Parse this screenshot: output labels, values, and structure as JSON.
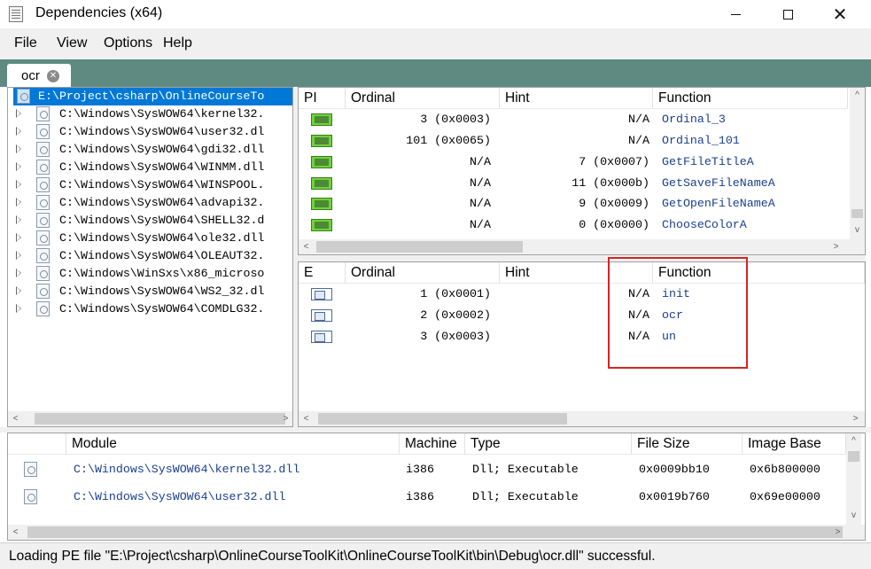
{
  "window": {
    "title": "Dependencies (x64)"
  },
  "menu": [
    "File",
    "View",
    "Options",
    "Help"
  ],
  "tab": {
    "label": "ocr"
  },
  "tree": [
    "E:\\Project\\csharp\\OnlineCourseTo",
    "C:\\Windows\\SysWOW64\\kernel32.",
    "C:\\Windows\\SysWOW64\\user32.dl",
    "C:\\Windows\\SysWOW64\\gdi32.dll",
    "C:\\Windows\\SysWOW64\\WINMM.dll",
    "C:\\Windows\\SysWOW64\\WINSPOOL.",
    "C:\\Windows\\SysWOW64\\advapi32.",
    "C:\\Windows\\SysWOW64\\SHELL32.d",
    "C:\\Windows\\SysWOW64\\ole32.dll",
    "C:\\Windows\\SysWOW64\\OLEAUT32.",
    "C:\\Windows\\WinSxs\\x86_microso",
    "C:\\Windows\\SysWOW64\\WS2_32.dl",
    "C:\\Windows\\SysWOW64\\COMDLG32."
  ],
  "imports": {
    "headers": [
      "PI",
      "Ordinal",
      "Hint",
      "Function"
    ],
    "rows": [
      {
        "ordinal": "3 (0x0003)",
        "hint": "N/A",
        "function": "Ordinal_3"
      },
      {
        "ordinal": "101 (0x0065)",
        "hint": "N/A",
        "function": "Ordinal_101"
      },
      {
        "ordinal": "N/A",
        "hint": "7 (0x0007)",
        "function": "GetFileTitleA"
      },
      {
        "ordinal": "N/A",
        "hint": "11 (0x000b)",
        "function": "GetSaveFileNameA"
      },
      {
        "ordinal": "N/A",
        "hint": "9 (0x0009)",
        "function": "GetOpenFileNameA"
      },
      {
        "ordinal": "N/A",
        "hint": "0 (0x0000)",
        "function": "ChooseColorA"
      }
    ]
  },
  "exports": {
    "headers": [
      "E",
      "Ordinal",
      "Hint",
      "Function"
    ],
    "rows": [
      {
        "ordinal": "1 (0x0001)",
        "hint": "N/A",
        "function": "init"
      },
      {
        "ordinal": "2 (0x0002)",
        "hint": "N/A",
        "function": "ocr"
      },
      {
        "ordinal": "3 (0x0003)",
        "hint": "N/A",
        "function": "un"
      }
    ]
  },
  "modules": {
    "headers": [
      "Module",
      "Machine",
      "Type",
      "File Size",
      "Image Base"
    ],
    "rows": [
      {
        "module": "C:\\Windows\\SysWOW64\\kernel32.dll",
        "machine": "i386",
        "type": "Dll; Executable",
        "size": "0x0009bb10",
        "base": "0x6b800000"
      },
      {
        "module": "C:\\Windows\\SysWOW64\\user32.dll",
        "machine": "i386",
        "type": "Dll; Executable",
        "size": "0x0019b760",
        "base": "0x69e00000"
      }
    ]
  },
  "status": "Loading PE file \"E:\\Project\\csharp\\OnlineCourseToolKit\\OnlineCourseToolKit\\bin\\Debug\\ocr.dll\" successful."
}
